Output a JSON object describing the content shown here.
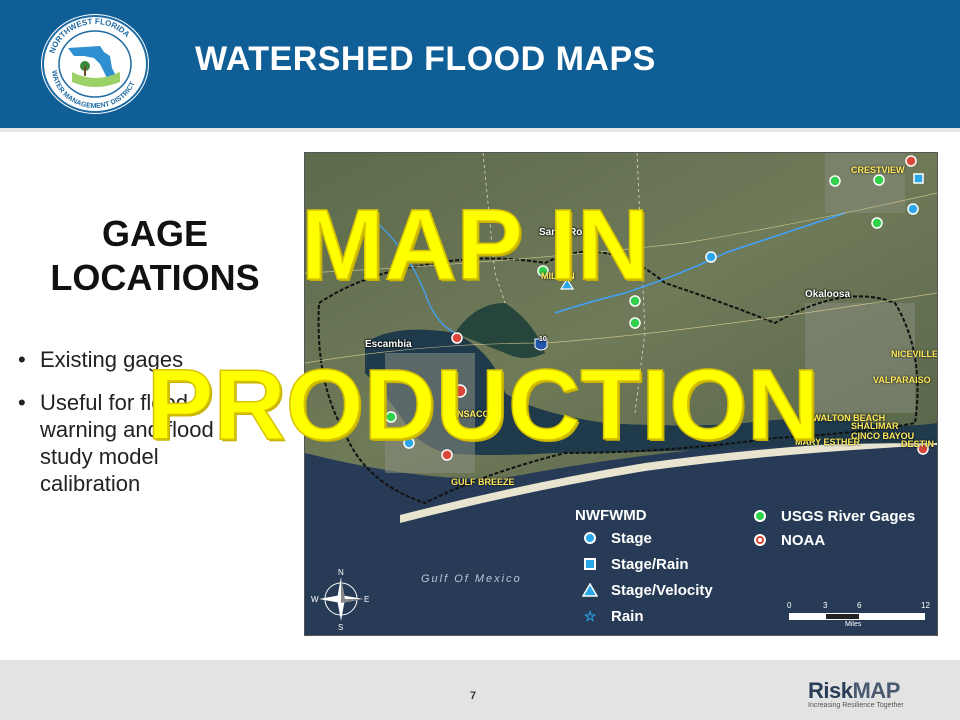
{
  "header": {
    "title": "WATERSHED FLOOD MAPS",
    "logo_text": "NORTHWEST FLORIDA WATER MANAGEMENT DISTRICT"
  },
  "left": {
    "heading_line1": "GAGE",
    "heading_line2": "LOCATIONS",
    "bullets": [
      "Existing gages",
      "Useful for flood warning and flood study model calibration"
    ]
  },
  "map": {
    "labels": {
      "crestview": "CRESTVIEW",
      "santa_rosa": "Santa Rosa",
      "milton": "MILTON",
      "okaloosa": "Okaloosa",
      "escambia": "Escambia",
      "niceville": "NICEVILLE",
      "valparaiso": "VALPARAISO",
      "pensacola": "PENSACOLA",
      "gulf_breeze": "GULF BREEZE",
      "destin": "DESTIN",
      "ft_walton": "FT WALTON BEACH",
      "mary_esther": "MARY ESTHER",
      "shalimar": "SHALIMAR",
      "cinco": "CINCO BAYOU",
      "gulf": "Gulf Of Mexico",
      "interstate": "10"
    },
    "legend": {
      "left_title": "NWFWMD",
      "items": [
        "Stage",
        "Stage/Rain",
        "Stage/Velocity",
        "Rain"
      ],
      "right_items": [
        "USGS River Gages",
        "NOAA"
      ]
    },
    "scale": {
      "ticks": [
        "0",
        "3",
        "6",
        "12"
      ],
      "unit": "Miles"
    },
    "compass": {
      "n": "N",
      "s": "S",
      "e": "E",
      "w": "W"
    }
  },
  "overlay": {
    "line1": "MAP IN",
    "line2": "PRODUCTION"
  },
  "footer": {
    "page_number": "7",
    "brand": "RiskMAP",
    "brand_part1": "Risk",
    "brand_part2": "MAP",
    "tagline": "Increasing Resilience Together"
  },
  "colors": {
    "header_blue": "#0f5e96",
    "overlay_yellow": "#ffff00",
    "usgs_green": "#2fd04a",
    "noaa_red": "#d8473a",
    "stage_blue": "#2aa7e8"
  }
}
